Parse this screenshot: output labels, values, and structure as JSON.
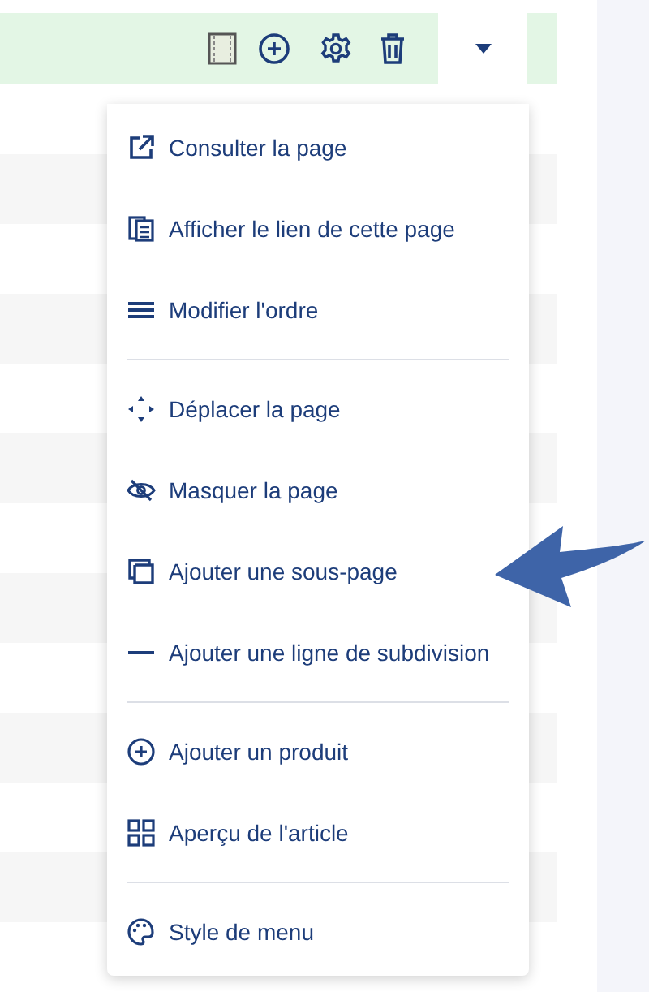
{
  "menu": {
    "groups": [
      [
        "Consulter la page",
        "Afficher le lien de cette page",
        "Modifier l'ordre"
      ],
      [
        "Déplacer la page",
        "Masquer la page",
        "Ajouter une sous-page",
        "Ajouter une ligne de subdivision"
      ],
      [
        "Ajouter un produit",
        "Aperçu de l'article"
      ],
      [
        "Style de menu"
      ]
    ]
  }
}
